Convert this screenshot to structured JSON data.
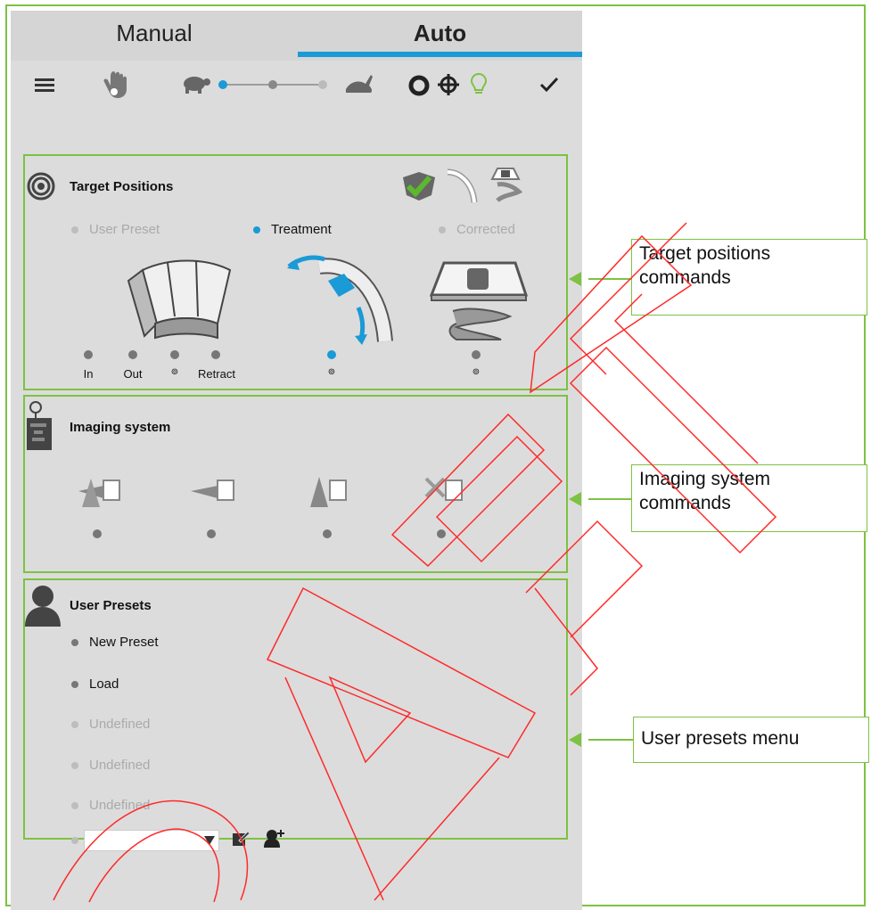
{
  "tabs": {
    "manual": "Manual",
    "auto": "Auto"
  },
  "toolbar": {
    "icons": [
      "menu-icon",
      "hand-logo-icon",
      "turtle-icon",
      "speed-slider",
      "rabbit-icon",
      "circle-icon",
      "crosshair-icon",
      "lightbulb-icon",
      "check-icon"
    ],
    "accent": "#1a9ad6",
    "highlight": "#7dc242"
  },
  "target": {
    "title": "Target Positions",
    "options": [
      "User Preset",
      "Treatment",
      "Corrected"
    ],
    "selected": "Treatment",
    "nozzle_labels": [
      "In",
      "Out",
      "⊚",
      "Retract"
    ],
    "gantry_label": "⊚",
    "couch_label": "⊚"
  },
  "imaging": {
    "title": "Imaging system"
  },
  "presets": {
    "title": "User Presets",
    "items": [
      "New Preset",
      "Load",
      "Undefined",
      "Undefined",
      "Undefined"
    ],
    "dropdown_value": ""
  },
  "callouts": {
    "target": "Target positions commands",
    "imaging": "Imaging system commands",
    "presets": "User presets menu"
  }
}
